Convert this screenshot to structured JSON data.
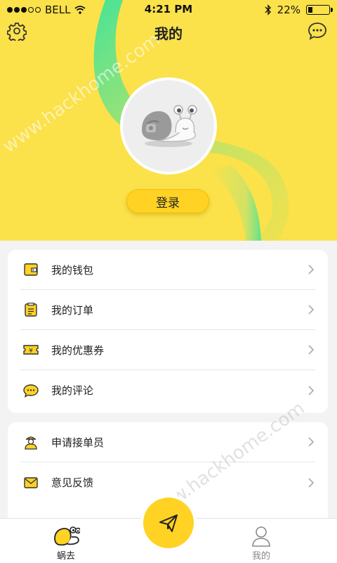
{
  "status_bar": {
    "carrier": "BELL",
    "time": "4:21 PM",
    "battery": "22%",
    "battery_level": 0.22,
    "signal_dots_filled": 3,
    "signal_dots_total": 5,
    "icons": [
      "wifi-icon",
      "bluetooth-icon",
      "battery-icon"
    ]
  },
  "header": {
    "title": "我的",
    "left_icon": "gear-icon",
    "right_icon": "chat-bubble-icon",
    "login_label": "登录",
    "colors": {
      "yellow": "#fbe14a",
      "green_accent": "#4fe39a",
      "button": "#ffd224"
    }
  },
  "menu_group_1": [
    {
      "label": "我的钱包",
      "icon": "wallet-icon"
    },
    {
      "label": "我的订单",
      "icon": "order-list-icon"
    },
    {
      "label": "我的优惠券",
      "icon": "coupon-icon"
    },
    {
      "label": "我的评论",
      "icon": "comment-icon"
    }
  ],
  "menu_group_2": [
    {
      "label": "申请接单员",
      "icon": "courier-icon"
    },
    {
      "label": "意见反馈",
      "icon": "feedback-mail-icon"
    }
  ],
  "tabbar": {
    "home_label": "蜗去",
    "me_label": "我的",
    "fab_icon": "paper-plane-icon"
  },
  "watermark": "www.hackhome.com"
}
